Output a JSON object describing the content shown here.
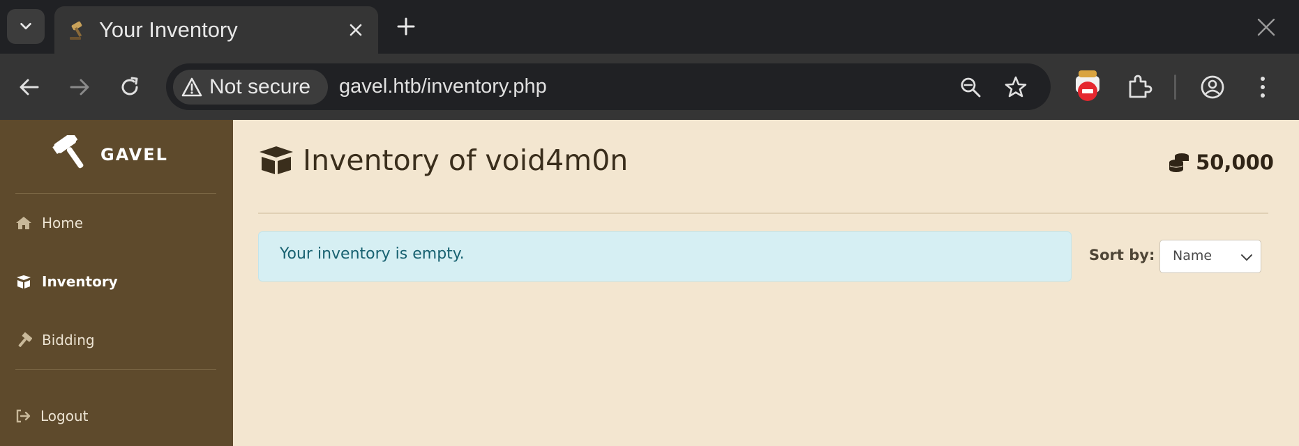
{
  "browser": {
    "tab_title": "Your Inventory",
    "security_label": "Not secure",
    "url": "gavel.htb/inventory.php"
  },
  "sidebar": {
    "brand": "GAVEL",
    "items": [
      {
        "label": "Home",
        "icon": "home-icon"
      },
      {
        "label": "Inventory",
        "icon": "box-open-icon",
        "active": true
      },
      {
        "label": "Bidding",
        "icon": "hammer-icon"
      },
      {
        "label": "Logout",
        "icon": "logout-icon"
      }
    ]
  },
  "main": {
    "title": "Inventory of void4m0n",
    "balance": "50,000",
    "alert": "Your inventory is empty.",
    "sort_label": "Sort by:",
    "sort_value": "Name"
  },
  "colors": {
    "sidebar_bg": "#5e4a2c",
    "main_bg": "#f3e6d0",
    "alert_bg": "#d6eff3",
    "alert_text": "#176170"
  }
}
